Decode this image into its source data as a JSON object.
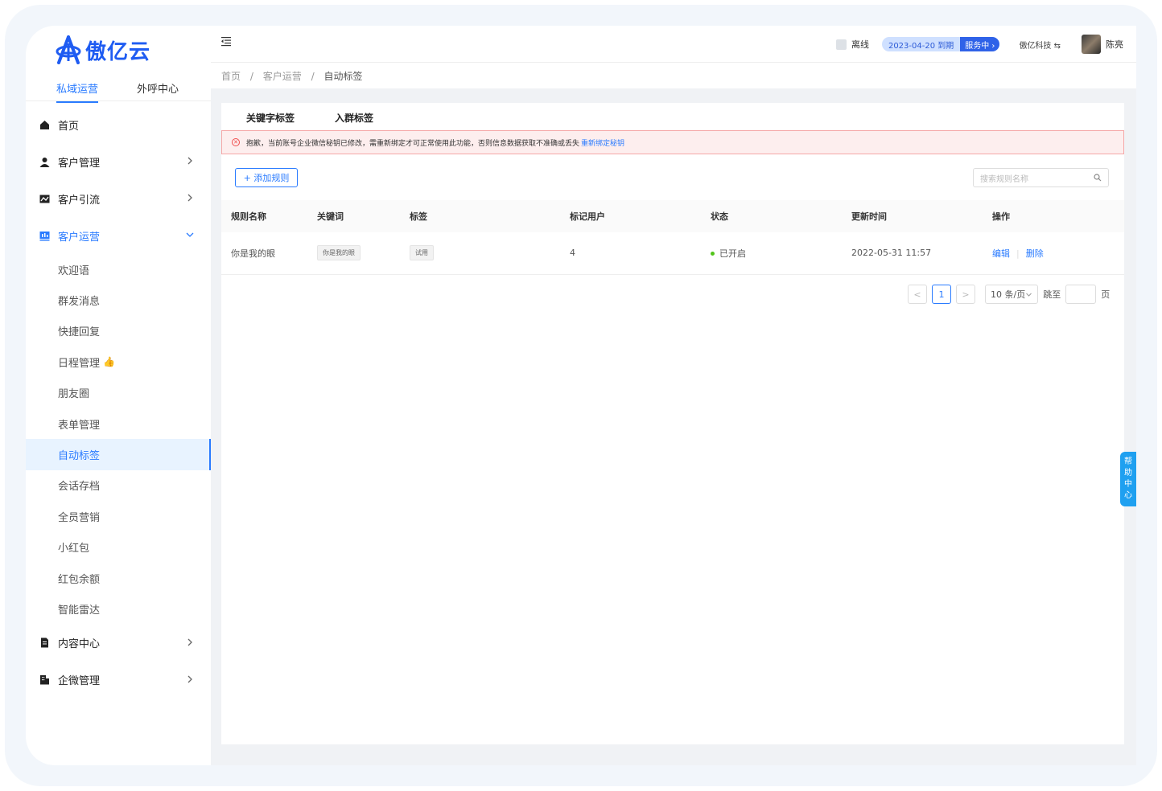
{
  "brand": {
    "name": "傲亿云"
  },
  "sidebar": {
    "top_tabs": [
      {
        "label": "私域运营"
      },
      {
        "label": "外呼中心"
      }
    ],
    "menu": [
      {
        "label": "首页",
        "icon": "home-icon"
      },
      {
        "label": "客户管理",
        "icon": "user-icon"
      },
      {
        "label": "客户引流",
        "icon": "traffic-icon"
      },
      {
        "label": "客户运营",
        "icon": "operation-icon"
      }
    ],
    "submenu": [
      {
        "label": "欢迎语"
      },
      {
        "label": "群发消息"
      },
      {
        "label": "快捷回复"
      },
      {
        "label": "日程管理"
      },
      {
        "label": "朋友圈"
      },
      {
        "label": "表单管理"
      },
      {
        "label": "自动标签"
      },
      {
        "label": "会话存档"
      },
      {
        "label": "全员营销"
      },
      {
        "label": "小红包"
      },
      {
        "label": "红包余额"
      },
      {
        "label": "智能雷达"
      }
    ],
    "menu_bottom": [
      {
        "label": "内容中心",
        "icon": "document-icon"
      },
      {
        "label": "企微管理",
        "icon": "building-icon"
      }
    ]
  },
  "header": {
    "status": "离线",
    "expire_text": "2023-04-20 到期",
    "service_label": "服务中 ›",
    "company": "傲亿科技 ⇆",
    "user_name": "陈亮"
  },
  "breadcrumb": {
    "items": [
      "首页",
      "客户运营",
      "自动标签"
    ],
    "separator": "/"
  },
  "content": {
    "tabs": [
      {
        "label": "关键字标签"
      },
      {
        "label": "入群标签"
      }
    ],
    "alert": {
      "text": "抱歉，当前账号企业微信秘钥已修改，需重新绑定才可正常使用此功能，否则信息数据获取不准确或丢失",
      "link": "重新绑定秘钥"
    },
    "add_button": "+ 添加规则",
    "search_placeholder": "搜索规则名称",
    "table": {
      "columns": [
        "规则名称",
        "关键词",
        "标签",
        "标记用户",
        "状态",
        "更新时间",
        "操作"
      ],
      "rows": [
        {
          "name": "你是我的眼",
          "keyword": "你是我的眼",
          "tag": "试用",
          "users": "4",
          "status": "已开启",
          "updated": "2022-05-31 11:57",
          "edit": "编辑",
          "delete": "删除"
        }
      ]
    },
    "pagination": {
      "prev": "<",
      "current": "1",
      "next": ">",
      "page_size": "10 条/页",
      "jump_label": "跳至",
      "page_suffix": "页"
    }
  },
  "help": {
    "label": [
      "帮",
      "助",
      "中",
      "心"
    ]
  },
  "colors": {
    "primary": "#2a7bff",
    "brand": "#1f5cf2",
    "alert_bg": "#fdeeee",
    "status_on": "#52c41a"
  }
}
